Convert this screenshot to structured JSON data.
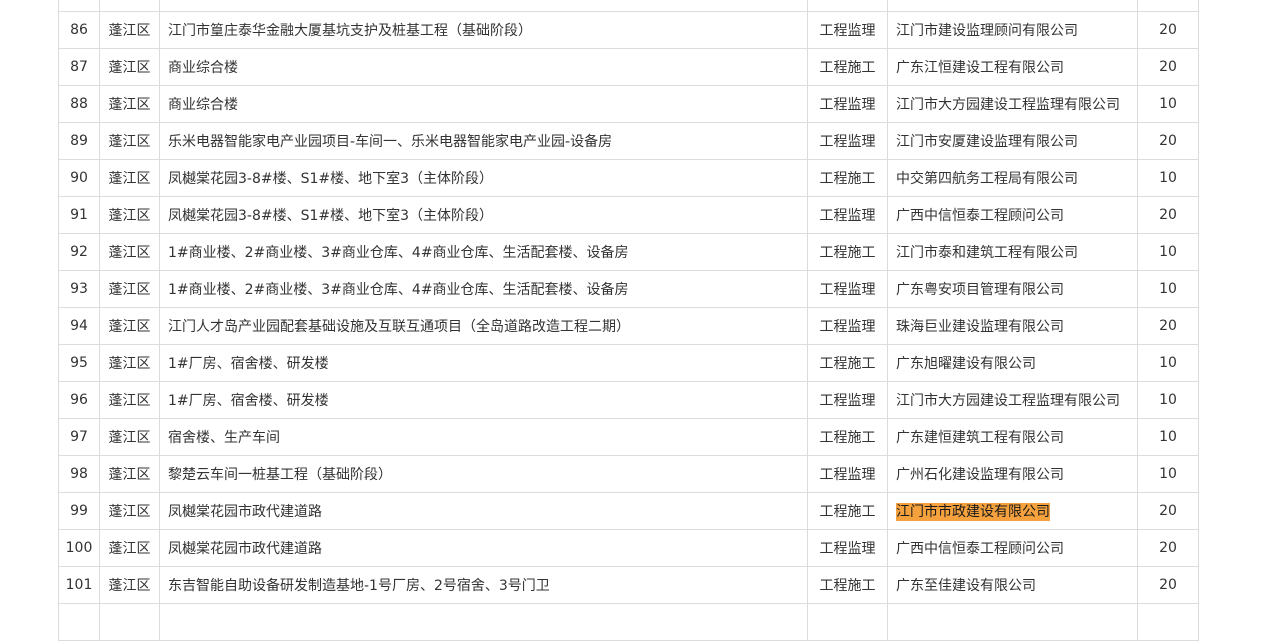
{
  "table": {
    "highlight_color": "#f5a13d",
    "rows": [
      {
        "no": "",
        "district": "",
        "project": "",
        "type": "",
        "company": "",
        "score": ""
      },
      {
        "no": "86",
        "district": "蓬江区",
        "project": "江门市篁庄泰华金融大厦基坑支护及桩基工程（基础阶段）",
        "type": "工程监理",
        "company": "江门市建设监理顾问有限公司",
        "score": "20"
      },
      {
        "no": "87",
        "district": "蓬江区",
        "project": "商业综合楼",
        "type": "工程施工",
        "company": "广东江恒建设工程有限公司",
        "score": "20"
      },
      {
        "no": "88",
        "district": "蓬江区",
        "project": "商业综合楼",
        "type": "工程监理",
        "company": "江门市大方园建设工程监理有限公司",
        "score": "10"
      },
      {
        "no": "89",
        "district": "蓬江区",
        "project": "乐米电器智能家电产业园项目-车间一、乐米电器智能家电产业园-设备房",
        "type": "工程监理",
        "company": "江门市安厦建设监理有限公司",
        "score": "20"
      },
      {
        "no": "90",
        "district": "蓬江区",
        "project": "凤樾棠花园3-8#楼、S1#楼、地下室3（主体阶段）",
        "type": "工程施工",
        "company": "中交第四航务工程局有限公司",
        "score": "10"
      },
      {
        "no": "91",
        "district": "蓬江区",
        "project": "凤樾棠花园3-8#楼、S1#楼、地下室3（主体阶段）",
        "type": "工程监理",
        "company": "广西中信恒泰工程顾问公司",
        "score": "20"
      },
      {
        "no": "92",
        "district": "蓬江区",
        "project": "1#商业楼、2#商业楼、3#商业仓库、4#商业仓库、生活配套楼、设备房",
        "type": "工程施工",
        "company": "江门市泰和建筑工程有限公司",
        "score": "10"
      },
      {
        "no": "93",
        "district": "蓬江区",
        "project": "1#商业楼、2#商业楼、3#商业仓库、4#商业仓库、生活配套楼、设备房",
        "type": "工程监理",
        "company": "广东粤安项目管理有限公司",
        "score": "10"
      },
      {
        "no": "94",
        "district": "蓬江区",
        "project": "江门人才岛产业园配套基础设施及互联互通项目（全岛道路改造工程二期）",
        "type": "工程监理",
        "company": "珠海巨业建设监理有限公司",
        "score": "20"
      },
      {
        "no": "95",
        "district": "蓬江区",
        "project": "1#厂房、宿舍楼、研发楼",
        "type": "工程施工",
        "company": "广东旭曜建设有限公司",
        "score": "10"
      },
      {
        "no": "96",
        "district": "蓬江区",
        "project": "1#厂房、宿舍楼、研发楼",
        "type": "工程监理",
        "company": "江门市大方园建设工程监理有限公司",
        "score": "10"
      },
      {
        "no": "97",
        "district": "蓬江区",
        "project": "宿舍楼、生产车间",
        "type": "工程施工",
        "company": "广东建恒建筑工程有限公司",
        "score": "10"
      },
      {
        "no": "98",
        "district": "蓬江区",
        "project": "黎楚云车间一桩基工程（基础阶段）",
        "type": "工程监理",
        "company": "广州石化建设监理有限公司",
        "score": "10"
      },
      {
        "no": "99",
        "district": "蓬江区",
        "project": "凤樾棠花园市政代建道路",
        "type": "工程施工",
        "company": "江门市市政建设有限公司",
        "score": "20",
        "highlight": true
      },
      {
        "no": "100",
        "district": "蓬江区",
        "project": "凤樾棠花园市政代建道路",
        "type": "工程监理",
        "company": "广西中信恒泰工程顾问公司",
        "score": "20"
      },
      {
        "no": "101",
        "district": "蓬江区",
        "project": "东吉智能自助设备研发制造基地-1号厂房、2号宿舍、3号门卫",
        "type": "工程施工",
        "company": "广东至佳建设有限公司",
        "score": "20"
      },
      {
        "no": "",
        "district": "",
        "project": "",
        "type": "",
        "company": "",
        "score": ""
      }
    ]
  }
}
